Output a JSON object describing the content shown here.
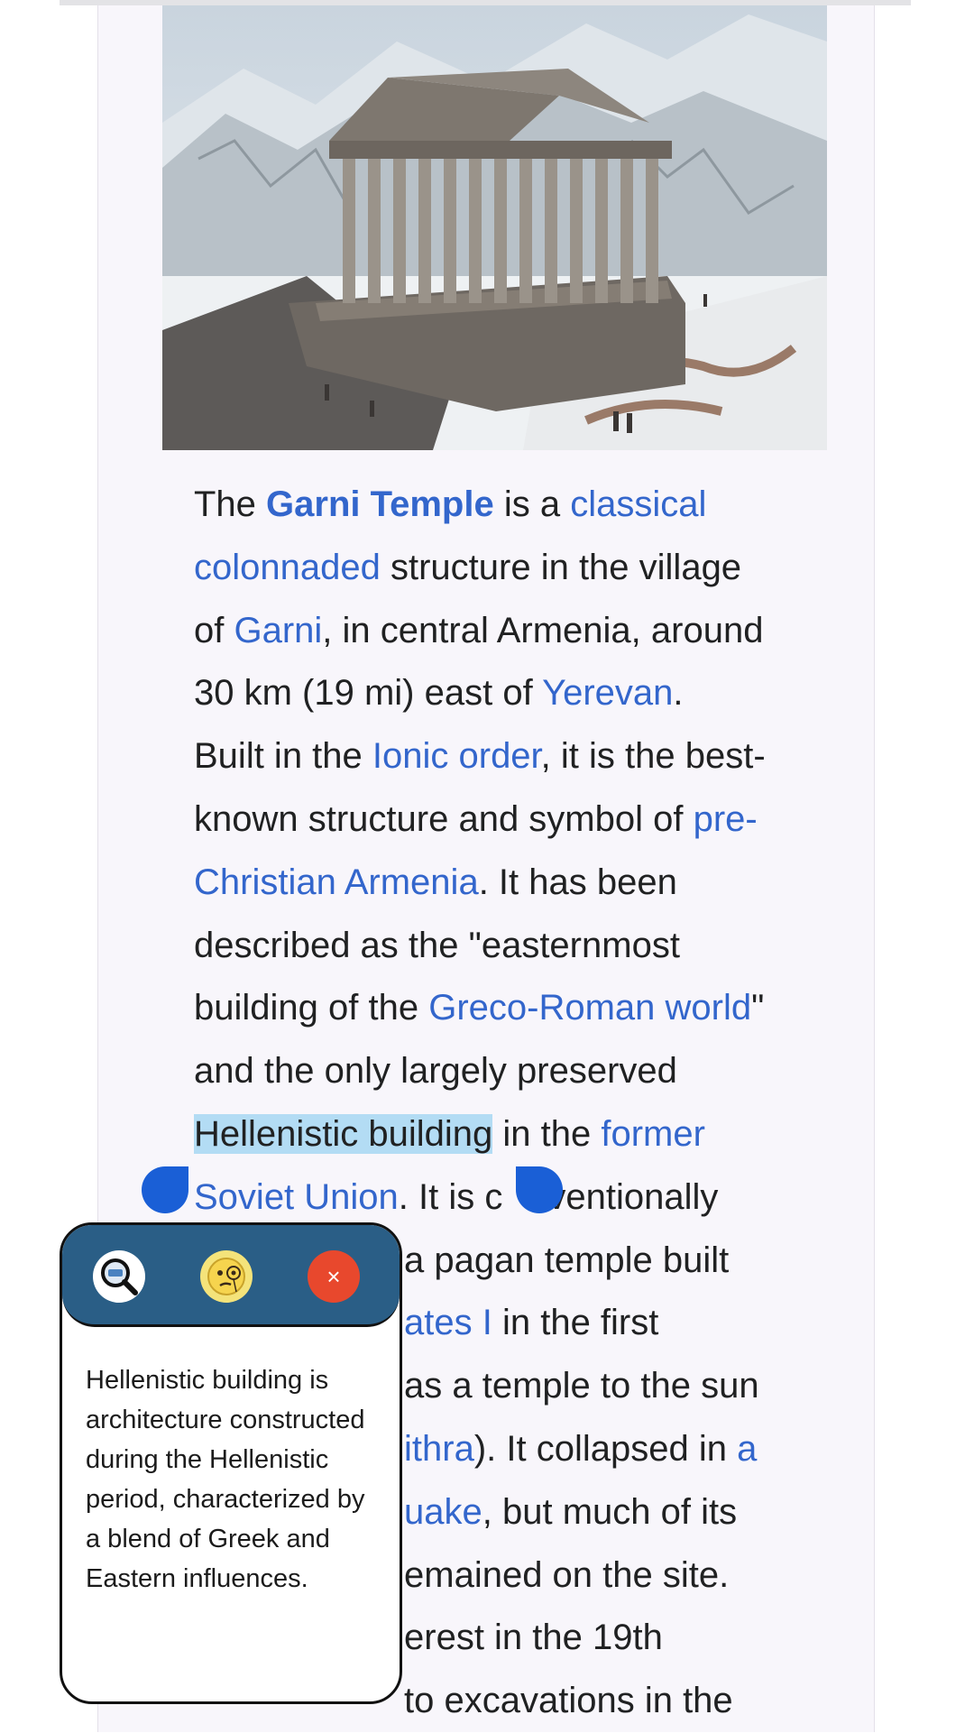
{
  "article": {
    "lines": [
      [
        {
          "t": "The "
        },
        {
          "t": "Garni Temple",
          "bold": true,
          "link": true
        },
        {
          "t": " is a "
        },
        {
          "t": "classical",
          "link": true
        }
      ],
      [
        {
          "t": "colonnaded",
          "link": true
        },
        {
          "t": " structure in the village"
        }
      ],
      [
        {
          "t": "of "
        },
        {
          "t": "Garni",
          "link": true
        },
        {
          "t": ", in central Armenia, around"
        }
      ],
      [
        {
          "t": "30 km (19 mi) east of "
        },
        {
          "t": "Yerevan",
          "link": true
        },
        {
          "t": "."
        }
      ],
      [
        {
          "t": "Built in the "
        },
        {
          "t": "Ionic order",
          "link": true
        },
        {
          "t": ", it is the best-"
        }
      ],
      [
        {
          "t": "known structure and symbol of "
        },
        {
          "t": "pre-",
          "link": true
        }
      ],
      [
        {
          "t": "Christian Armenia",
          "link": true
        },
        {
          "t": ". It has been"
        }
      ],
      [
        {
          "t": "described as the \"easternmost"
        }
      ],
      [
        {
          "t": "building of the "
        },
        {
          "t": "Greco-Roman world",
          "link": true
        },
        {
          "t": "\""
        }
      ],
      [
        {
          "t": "and the only largely preserved"
        }
      ],
      [
        {
          "t": "Hellenistic building",
          "selected": true
        },
        {
          "t": " in the "
        },
        {
          "t": "former",
          "link": true
        }
      ],
      [
        {
          "t": "Soviet Union",
          "link": true
        },
        {
          "t": ". It is c"
        },
        {
          "t": "    ",
          "gap": true
        },
        {
          "t": "ventionally"
        }
      ],
      [
        {
          "t": "a pagan temple built",
          "indent": true
        }
      ],
      [
        {
          "t": "ates I",
          "link": true,
          "indent": true
        },
        {
          "t": " in the first"
        }
      ],
      [
        {
          "t": "as a temple to the sun",
          "indent": true
        }
      ],
      [
        {
          "t": "ithra",
          "link": true,
          "indent": true
        },
        {
          "t": "). It collapsed in "
        },
        {
          "t": "a",
          "link": true
        }
      ],
      [
        {
          "t": "uake",
          "link": true,
          "indent": true
        },
        {
          "t": ", but much of its"
        }
      ],
      [
        {
          "t": "emained on the site.",
          "indent": true
        }
      ],
      [
        {
          "t": "erest in the 19th",
          "indent": true
        }
      ],
      [
        {
          "t": "to excavations in the",
          "indent": true
        }
      ]
    ]
  },
  "popup": {
    "definition": "Hellenistic building is architecture constructed during the Hellenistic period, characterized by a blend of Greek and Eastern influences.",
    "close_label": "×",
    "icons": [
      "magnifier-icon",
      "monocle-face-icon",
      "close-icon"
    ]
  },
  "colors": {
    "link": "#3366cc",
    "selection": "#b3dcf4",
    "handle": "#1a5fd6",
    "toolbar": "#2a5e86",
    "close": "#e8482d"
  }
}
